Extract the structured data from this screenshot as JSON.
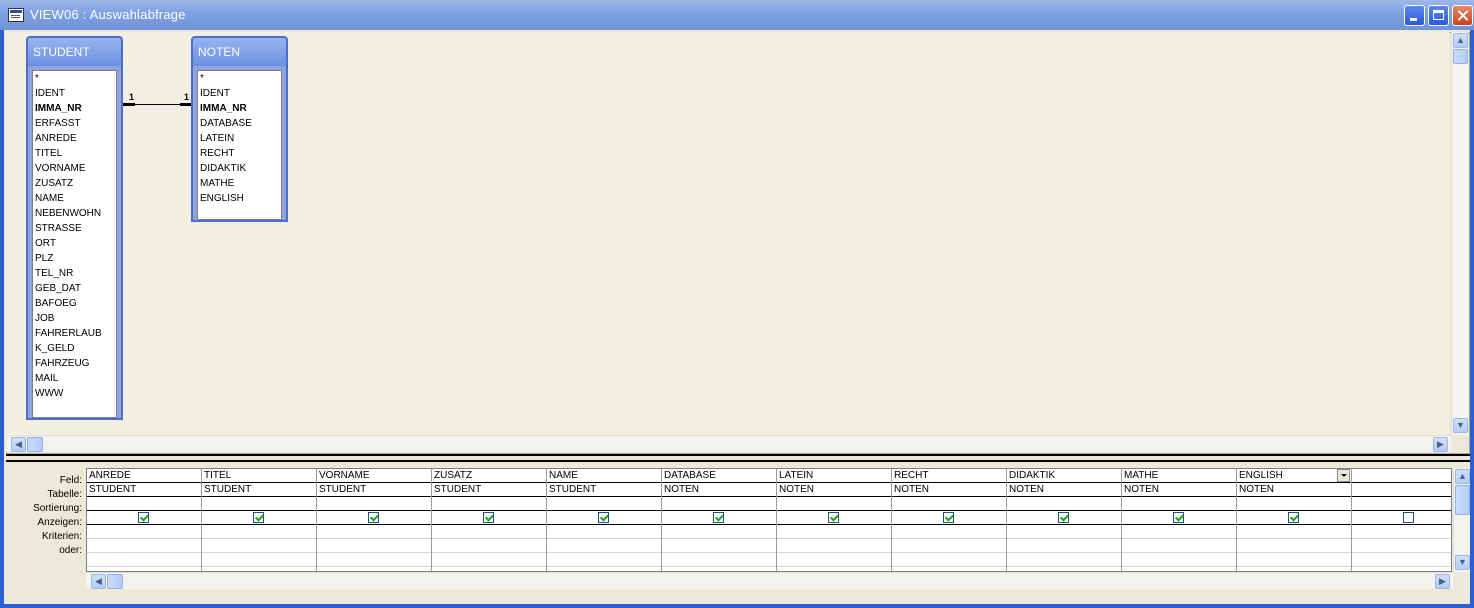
{
  "window": {
    "title": "VIEW06 : Auswahlabfrage"
  },
  "tables": [
    {
      "name": "STUDENT",
      "fields": [
        "*",
        "IDENT",
        "IMMA_NR",
        "ERFASST",
        "ANREDE",
        "TITEL",
        "VORNAME",
        "ZUSATZ",
        "NAME",
        "NEBENWOHN",
        "STRASSE",
        "ORT",
        "PLZ",
        "TEL_NR",
        "GEB_DAT",
        "BAFOEG",
        "JOB",
        "FAHRERLAUB",
        "K_GELD",
        "FAHRZEUG",
        "MAIL",
        "WWW"
      ],
      "key_field": "IMMA_NR"
    },
    {
      "name": "NOTEN",
      "fields": [
        "*",
        "IDENT",
        "IMMA_NR",
        "DATABASE",
        "LATEIN",
        "RECHT",
        "DIDAKTIK",
        "MATHE",
        "ENGLISH"
      ],
      "key_field": "IMMA_NR"
    }
  ],
  "relationship": {
    "left_cardinality": "1",
    "right_cardinality": "1"
  },
  "grid": {
    "row_labels": {
      "field": "Feld:",
      "table": "Tabelle:",
      "sort": "Sortierung:",
      "show": "Anzeigen:",
      "criteria": "Kriterien:",
      "or": "oder:"
    },
    "columns": [
      {
        "field": "ANREDE",
        "table": "STUDENT",
        "show": true
      },
      {
        "field": "TITEL",
        "table": "STUDENT",
        "show": true
      },
      {
        "field": "VORNAME",
        "table": "STUDENT",
        "show": true
      },
      {
        "field": "ZUSATZ",
        "table": "STUDENT",
        "show": true
      },
      {
        "field": "NAME",
        "table": "STUDENT",
        "show": true
      },
      {
        "field": "DATABASE",
        "table": "NOTEN",
        "show": true
      },
      {
        "field": "LATEIN",
        "table": "NOTEN",
        "show": true
      },
      {
        "field": "RECHT",
        "table": "NOTEN",
        "show": true
      },
      {
        "field": "DIDAKTIK",
        "table": "NOTEN",
        "show": true
      },
      {
        "field": "MATHE",
        "table": "NOTEN",
        "show": true
      },
      {
        "field": "ENGLISH",
        "table": "NOTEN",
        "show": true
      },
      {
        "field": "",
        "table": "",
        "show": false
      }
    ],
    "active_column": 10
  },
  "icons": {
    "window": "query-window-icon",
    "minimize": "minimize-icon",
    "maximize": "maximize-icon",
    "close": "close-icon"
  }
}
